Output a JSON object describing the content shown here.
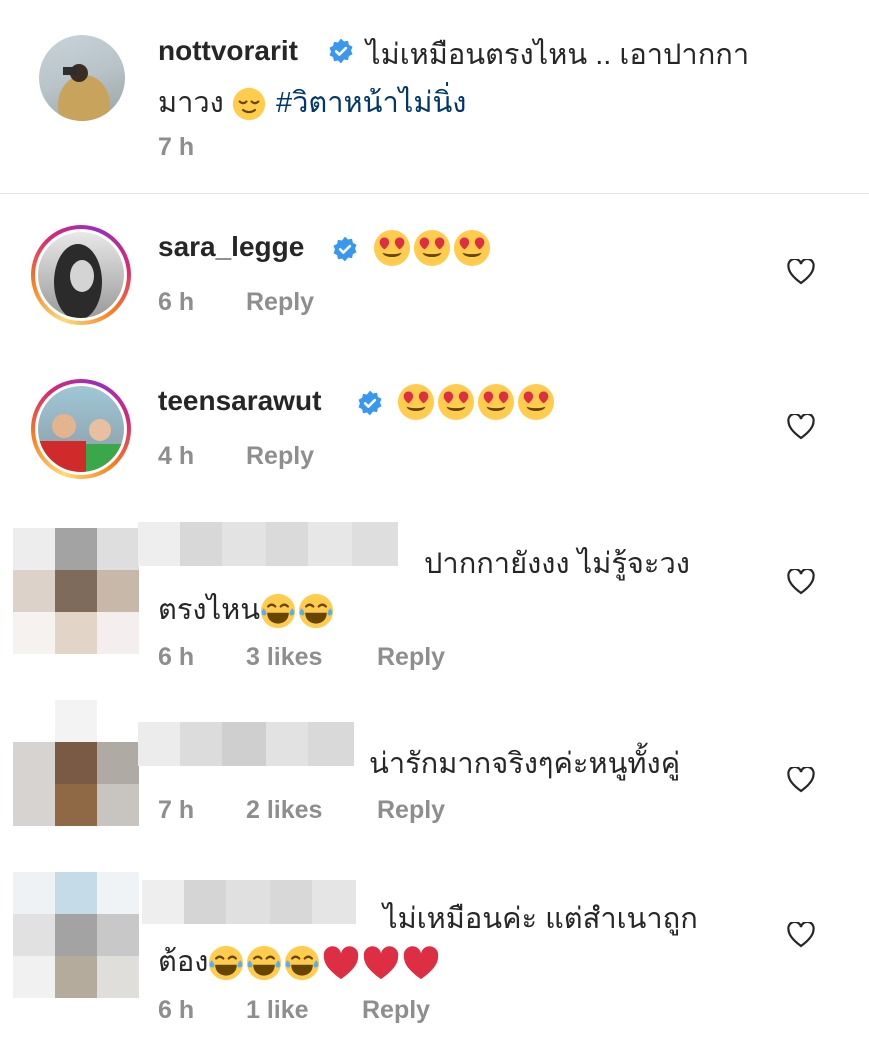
{
  "comments": [
    {
      "username": "nottvorarit",
      "verified": true,
      "text_line1": "ไม่เหมือนตรงไหน .. เอาปากกา",
      "text_line2": "มาวง",
      "hashtag": "#วิตาหน้าไม่นิ่ง",
      "time": "7 h"
    },
    {
      "username": "sara_legge",
      "verified": true,
      "time": "6 h",
      "reply": "Reply"
    },
    {
      "username": "teensarawut",
      "verified": true,
      "time": "4 h",
      "reply": "Reply"
    },
    {
      "text_line1": "ปากกายังงง ไม่รู้จะวง",
      "text_line2": "ตรงไหน",
      "time": "6 h",
      "likes": "3 likes",
      "reply": "Reply"
    },
    {
      "text_line1": "น่ารักมากจริงๆค่ะหนูทั้งคู่",
      "time": "7 h",
      "likes": "2 likes",
      "reply": "Reply"
    },
    {
      "text_line1": "ไม่เหมือนค่ะ แต่สำเนาถูก",
      "text_line2": "ต้อง",
      "time": "6 h",
      "likes": "1 like",
      "reply": "Reply"
    }
  ],
  "colors": {
    "verified_blue": "#3897f0",
    "hashtag": "#00376b",
    "meta_gray": "#8e8e8e",
    "heart_red": "#ed4956"
  }
}
